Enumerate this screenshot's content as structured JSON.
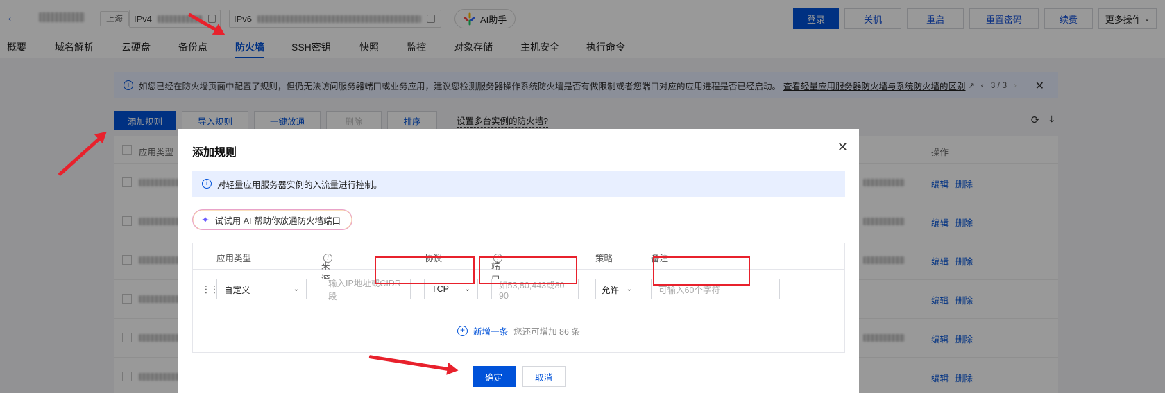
{
  "header": {
    "back_icon": "arrow-left-icon",
    "region": "上海",
    "ipv4_label": "IPv4",
    "ipv6_label": "IPv6",
    "ai_assistant": "AI助手",
    "actions": [
      "登录",
      "关机",
      "重启",
      "重置密码",
      "续费",
      "更多操作"
    ]
  },
  "tabs": [
    "概要",
    "域名解析",
    "云硬盘",
    "备份点",
    "防火墙",
    "SSH密钥",
    "快照",
    "监控",
    "对象存储",
    "主机安全",
    "执行命令"
  ],
  "active_tab": "防火墙",
  "notice": {
    "text": "如您已经在防火墙页面中配置了规则，但仍无法访问服务器端口或业务应用，建议您检测服务器操作系统防火墙是否有做限制或者您端口对应的应用进程是否已经启动。",
    "link": "查看轻量应用服务器防火墙与系统防火墙的区别",
    "pager": "3 / 3"
  },
  "toolbar": {
    "buttons": [
      "添加规则",
      "导入规则",
      "一键放通",
      "删除",
      "排序"
    ],
    "link": "设置多台实例的防火墙?"
  },
  "table": {
    "col_app_type": "应用类型",
    "col_ops": "操作",
    "op_edit": "编辑",
    "op_delete": "删除"
  },
  "modal": {
    "title": "添加规则",
    "tip": "对轻量应用服务器实例的入流量进行控制。",
    "ai_try": "试试用 AI 帮助你放通防火墙端口",
    "columns": {
      "app_type": "应用类型",
      "source": "来源",
      "protocol": "协议",
      "port": "端口",
      "policy": "策略",
      "note": "备注"
    },
    "row": {
      "app_type": "自定义",
      "source_placeholder": "输入IP地址或CIDR段",
      "protocol": "TCP",
      "port_placeholder": "如53,80,443或80-90",
      "policy": "允许",
      "note_placeholder": "可输入60个字符"
    },
    "add_new": "新增一条",
    "remaining": "您还可增加 86 条",
    "confirm": "确定",
    "cancel": "取消"
  }
}
